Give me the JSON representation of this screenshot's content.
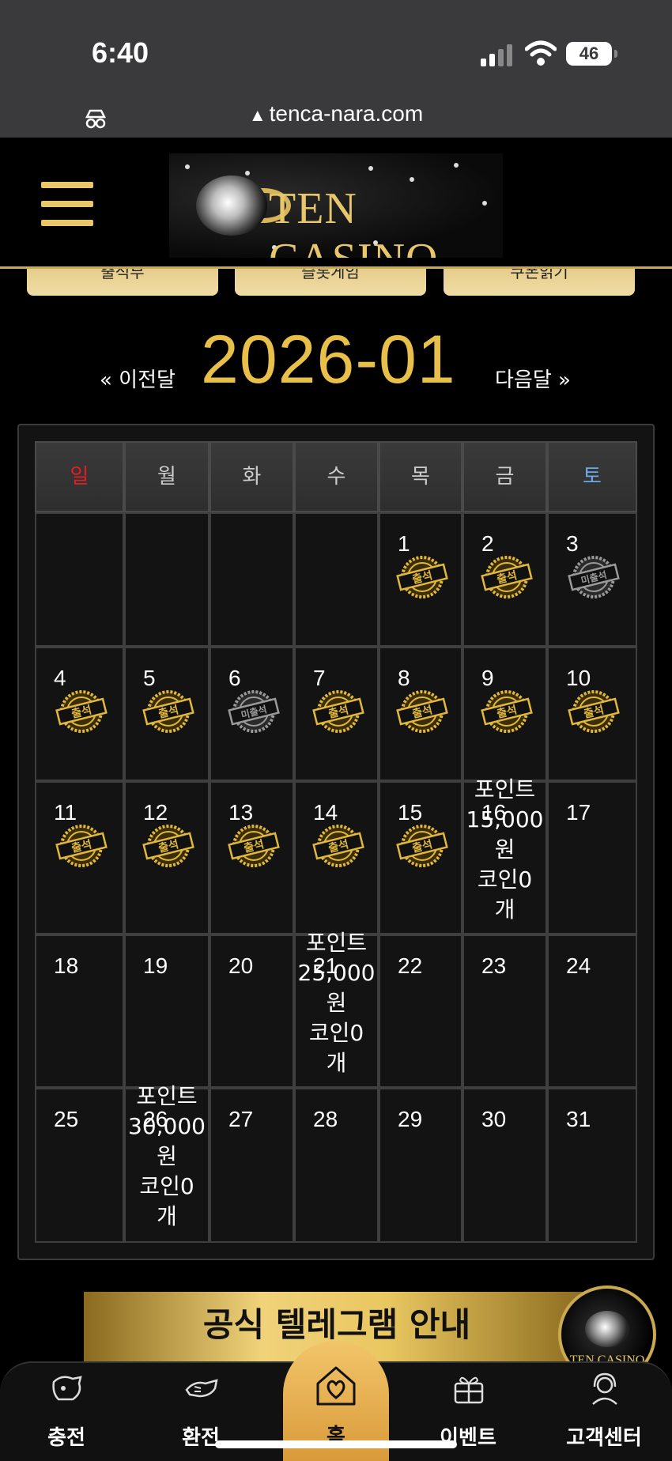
{
  "status_bar": {
    "time": "6:40",
    "battery": "46"
  },
  "browser": {
    "url": "tenca-nara.com"
  },
  "header": {
    "logo_text": "TEN CASINO"
  },
  "quick_buttons": [
    "출석부",
    "슬롯게임",
    "쿠폰읽기"
  ],
  "calendar": {
    "month": "2026-01",
    "prev_label": "« 이전달",
    "next_label": "다음달 »",
    "weekdays": [
      "일",
      "월",
      "화",
      "수",
      "목",
      "금",
      "토"
    ],
    "weekday_colors": {
      "sun": "#e02020",
      "sat": "#6aa8e8",
      "default": "#cccccc"
    },
    "stamp_labels": {
      "attended": "출석",
      "absent": "미출석"
    },
    "days": [
      {
        "d": "1",
        "status": "attended"
      },
      {
        "d": "2",
        "status": "attended"
      },
      {
        "d": "3",
        "status": "absent"
      },
      {
        "d": "4",
        "status": "attended"
      },
      {
        "d": "5",
        "status": "attended"
      },
      {
        "d": "6",
        "status": "absent"
      },
      {
        "d": "7",
        "status": "attended"
      },
      {
        "d": "8",
        "status": "attended"
      },
      {
        "d": "9",
        "status": "attended"
      },
      {
        "d": "10",
        "status": "attended"
      },
      {
        "d": "11",
        "status": "attended"
      },
      {
        "d": "12",
        "status": "attended"
      },
      {
        "d": "13",
        "status": "attended"
      },
      {
        "d": "14",
        "status": "attended"
      },
      {
        "d": "15",
        "status": "attended"
      },
      {
        "d": "16",
        "status": "none"
      },
      {
        "d": "17",
        "status": "none"
      },
      {
        "d": "18",
        "status": "none"
      },
      {
        "d": "19",
        "status": "none"
      },
      {
        "d": "20",
        "status": "none"
      },
      {
        "d": "21",
        "status": "none"
      },
      {
        "d": "22",
        "status": "none"
      },
      {
        "d": "23",
        "status": "none"
      },
      {
        "d": "24",
        "status": "none"
      },
      {
        "d": "25",
        "status": "none"
      },
      {
        "d": "26",
        "status": "none"
      },
      {
        "d": "27",
        "status": "none"
      },
      {
        "d": "28",
        "status": "none"
      },
      {
        "d": "29",
        "status": "none"
      },
      {
        "d": "30",
        "status": "none"
      },
      {
        "d": "31",
        "status": "none"
      }
    ],
    "rewards": [
      {
        "day": "16",
        "lines": [
          "포인트",
          "15,000",
          "원",
          "코인0",
          "개"
        ]
      },
      {
        "day": "21",
        "lines": [
          "포인트",
          "25,000",
          "원",
          "코인0",
          "개"
        ]
      },
      {
        "day": "26",
        "lines": [
          "포인트",
          "30,000",
          "원",
          "코인0",
          "개"
        ]
      }
    ]
  },
  "banner": {
    "text": "공식 텔레그램 안내"
  },
  "float_logo": {
    "text": "TEN CASINO"
  },
  "bottom_nav": {
    "charge": "충전",
    "exchange": "환전",
    "home": "홈",
    "event": "이벤트",
    "support": "고객센터"
  },
  "colors": {
    "gold": "#e8c049",
    "accent": "#c9a951"
  }
}
